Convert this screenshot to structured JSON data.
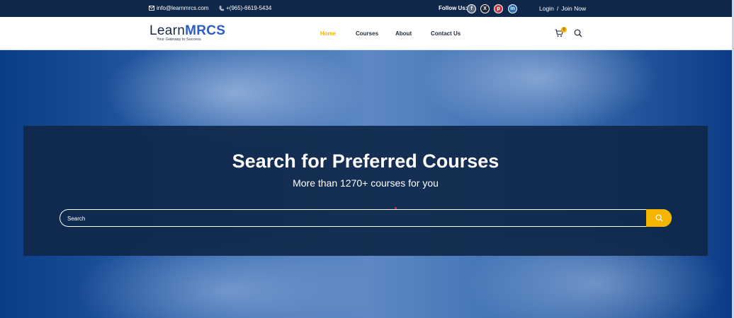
{
  "topbar": {
    "email": "info@learnmrcs.com",
    "phone": "+(965)-6619-5434",
    "follow_label": "Follow Us:",
    "social": [
      "facebook-icon",
      "x-icon",
      "pinterest-icon",
      "linkedin-icon"
    ],
    "login": "Login",
    "separator": "/",
    "join": "Join Now"
  },
  "logo": {
    "brand_main": "Learn",
    "brand_accent": "MRCS",
    "tagline": "Your Gateway to Success"
  },
  "nav": {
    "items": [
      "Home",
      "Courses",
      "About",
      "Contact Us"
    ],
    "active": "Home"
  },
  "cart": {
    "count": "0"
  },
  "hero": {
    "title": "Search for Preferred Courses",
    "subtitle": "More than 1270+ courses for you",
    "search_placeholder": "Search"
  },
  "colors": {
    "topbar_bg": "#0f2748",
    "accent_yellow": "#f4b400",
    "panel_bg": "#10284a",
    "brand_blue": "#2b5cc8"
  }
}
